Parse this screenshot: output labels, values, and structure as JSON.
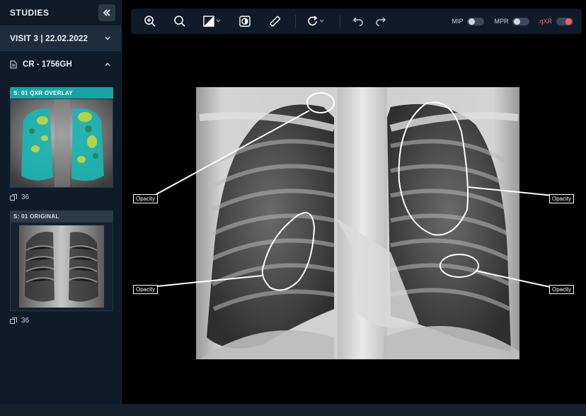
{
  "sidebar": {
    "title": "STUDIES",
    "visit": "VISIT 3 | 22.02.2022",
    "series": "CR - 1756GH",
    "thumbnails": [
      {
        "label": "S: 01  QXR OVERLAY",
        "count": "36",
        "active": true
      },
      {
        "label": "S: 01  ORIGINAL",
        "count": "36",
        "active": false
      }
    ]
  },
  "toolbar": {
    "tools": [
      "zoom-in-icon",
      "zoom-icon",
      "window-level-icon",
      "invert-icon",
      "measure-icon",
      "rotate-icon",
      "undo-icon",
      "redo-icon"
    ],
    "toggles": [
      {
        "label": "MIP",
        "on": false
      },
      {
        "label": "MPR",
        "on": false
      },
      {
        "label": "qXR",
        "on": true
      }
    ],
    "accent": "#ff5b5b"
  },
  "annotations": [
    {
      "label": "Opacity"
    },
    {
      "label": "Opacity"
    },
    {
      "label": "Opacity"
    },
    {
      "label": "Opacity"
    }
  ],
  "colors": {
    "sidebar_bg": "#0f1b28",
    "active_label": "#16a5a5"
  }
}
